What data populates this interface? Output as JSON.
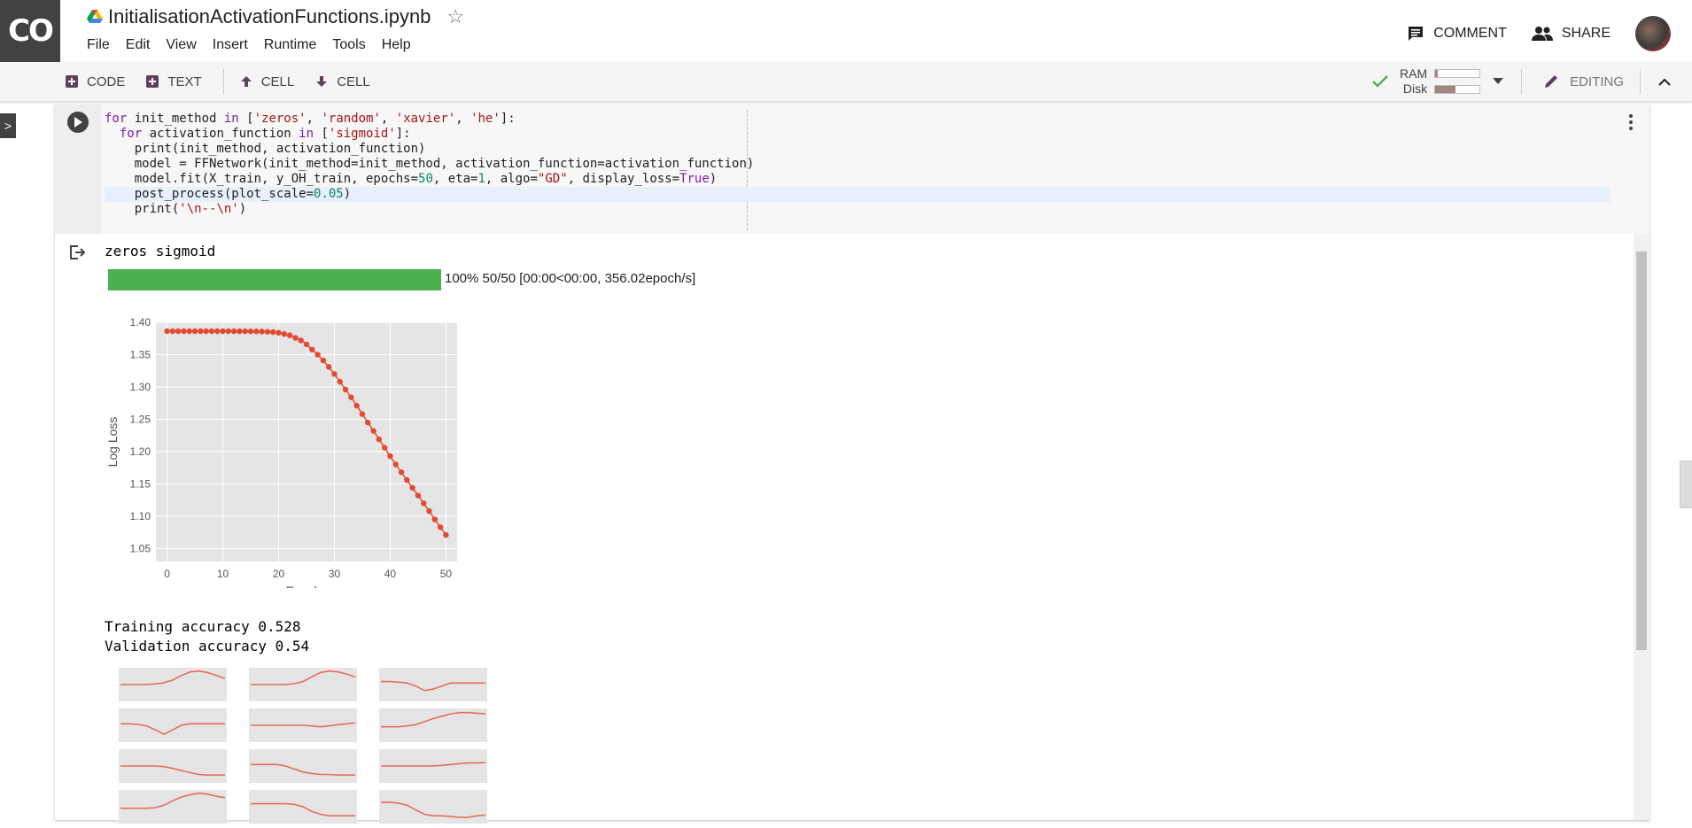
{
  "app": {
    "logo_text": "CO",
    "doc_title": "InitialisationActivationFunctions.ipynb"
  },
  "menu": [
    "File",
    "Edit",
    "View",
    "Insert",
    "Runtime",
    "Tools",
    "Help"
  ],
  "header_actions": {
    "comment": "COMMENT",
    "share": "SHARE"
  },
  "toolbar": {
    "code": "CODE",
    "text": "TEXT",
    "cell_up": "CELL",
    "cell_down": "CELL",
    "ram_label": "RAM",
    "disk_label": "Disk",
    "ram_usage": 0.05,
    "disk_usage": 0.45,
    "editing": "EDITING"
  },
  "cell": {
    "code_lines": [
      "for init_method in ['zeros', 'random', 'xavier', 'he']:",
      "  for activation_function in ['sigmoid']:",
      "    print(init_method, activation_function)",
      "    model = FFNetwork(init_method=init_method, activation_function=activation_function)",
      "    model.fit(X_train, y_OH_train, epochs=50, eta=1, algo=\"GD\", display_loss=True)",
      "    post_process(plot_scale=0.05)",
      "    print('\\n--\\n')"
    ],
    "highlighted_line": 5
  },
  "output": {
    "header_line": "zeros sigmoid",
    "progress": {
      "percent": 100,
      "text": "100% 50/50 [00:00<00:00, 356.02epoch/s]"
    },
    "train_acc": "Training accuracy 0.528",
    "val_acc": "Validation accuracy 0.54"
  },
  "chart_data": {
    "type": "line",
    "xlabel": "Epochs",
    "ylabel": "Log Loss",
    "xlim": [
      -2,
      52
    ],
    "ylim": [
      1.03,
      1.4
    ],
    "xticks": [
      0,
      10,
      20,
      30,
      40,
      50
    ],
    "yticks": [
      1.05,
      1.1,
      1.15,
      1.2,
      1.25,
      1.3,
      1.35,
      1.4
    ],
    "ytick_labels": [
      "1.05",
      "1.10",
      "1.15",
      "1.20",
      "1.25",
      "1.30",
      "1.35",
      "1.40"
    ],
    "grid": true,
    "color": "#e24a33",
    "x": [
      0,
      1,
      2,
      3,
      4,
      5,
      6,
      7,
      8,
      9,
      10,
      11,
      12,
      13,
      14,
      15,
      16,
      17,
      18,
      19,
      20,
      21,
      22,
      23,
      24,
      25,
      26,
      27,
      28,
      29,
      30,
      31,
      32,
      33,
      34,
      35,
      36,
      37,
      38,
      39,
      40,
      41,
      42,
      43,
      44,
      45,
      46,
      47,
      48,
      49,
      50
    ],
    "y": [
      1.3863,
      1.3863,
      1.3863,
      1.3863,
      1.3863,
      1.3863,
      1.3863,
      1.3863,
      1.3863,
      1.3863,
      1.3863,
      1.3863,
      1.3863,
      1.3862,
      1.3862,
      1.3861,
      1.386,
      1.3858,
      1.3854,
      1.385,
      1.384,
      1.382,
      1.38,
      1.376,
      1.372,
      1.366,
      1.358,
      1.35,
      1.341,
      1.331,
      1.32,
      1.308,
      1.296,
      1.284,
      1.271,
      1.258,
      1.245,
      1.232,
      1.219,
      1.206,
      1.193,
      1.18,
      1.168,
      1.156,
      1.144,
      1.132,
      1.12,
      1.108,
      1.095,
      1.083,
      1.071
    ]
  },
  "mini_plots": [
    [
      0.5,
      0.5,
      0.5,
      0.5,
      0.48,
      0.44,
      0.35,
      0.2,
      0.08,
      0.05,
      0.1,
      0.2,
      0.3
    ],
    [
      0.5,
      0.5,
      0.5,
      0.5,
      0.5,
      0.47,
      0.4,
      0.25,
      0.1,
      0.05,
      0.08,
      0.15,
      0.25
    ],
    [
      0.4,
      0.4,
      0.42,
      0.45,
      0.55,
      0.7,
      0.65,
      0.55,
      0.45,
      0.45,
      0.45,
      0.45,
      0.45
    ],
    [
      0.45,
      0.45,
      0.47,
      0.52,
      0.65,
      0.8,
      0.65,
      0.5,
      0.45,
      0.45,
      0.45,
      0.45,
      0.45
    ],
    [
      0.5,
      0.5,
      0.5,
      0.5,
      0.5,
      0.5,
      0.5,
      0.52,
      0.55,
      0.52,
      0.48,
      0.45,
      0.42
    ],
    [
      0.55,
      0.55,
      0.55,
      0.52,
      0.48,
      0.38,
      0.28,
      0.2,
      0.12,
      0.08,
      0.08,
      0.1,
      0.12
    ],
    [
      0.5,
      0.5,
      0.5,
      0.5,
      0.5,
      0.52,
      0.58,
      0.65,
      0.72,
      0.78,
      0.8,
      0.8,
      0.8
    ],
    [
      0.45,
      0.45,
      0.45,
      0.45,
      0.5,
      0.6,
      0.7,
      0.75,
      0.78,
      0.78,
      0.8,
      0.8,
      0.8
    ],
    [
      0.5,
      0.5,
      0.5,
      0.5,
      0.5,
      0.5,
      0.5,
      0.48,
      0.45,
      0.42,
      0.4,
      0.4,
      0.38
    ],
    [
      0.55,
      0.55,
      0.55,
      0.55,
      0.53,
      0.45,
      0.3,
      0.18,
      0.1,
      0.05,
      0.08,
      0.15,
      0.2
    ],
    [
      0.4,
      0.4,
      0.4,
      0.4,
      0.4,
      0.42,
      0.5,
      0.65,
      0.75,
      0.8,
      0.8,
      0.8,
      0.8
    ],
    [
      0.35,
      0.35,
      0.38,
      0.45,
      0.6,
      0.75,
      0.8,
      0.8,
      0.82,
      0.85,
      0.85,
      0.8,
      0.78
    ]
  ]
}
